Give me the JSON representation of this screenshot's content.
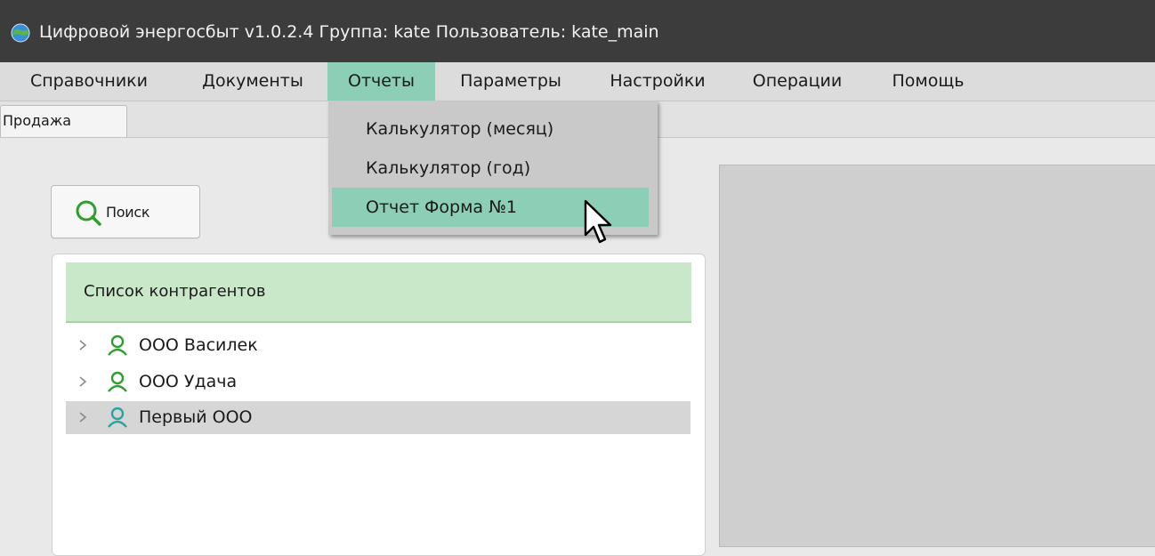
{
  "window": {
    "title": "Цифровой энергосбыт v1.0.2.4 Группа: kate Пользователь: kate_main",
    "app_icon": "globe-icon"
  },
  "menubar": {
    "items": [
      {
        "label": "Справочники"
      },
      {
        "label": "Документы"
      },
      {
        "label": "Отчеты",
        "active": true
      },
      {
        "label": "Параметры"
      },
      {
        "label": "Настройки"
      },
      {
        "label": "Операции"
      },
      {
        "label": "Помощь"
      }
    ]
  },
  "dropdown": {
    "items": [
      {
        "label": "Калькулятор (месяц)"
      },
      {
        "label": "Калькулятор (год)"
      },
      {
        "label": "Отчет Форма №1",
        "highlighted": true
      }
    ]
  },
  "tabs": [
    {
      "label": "Продажа"
    }
  ],
  "search": {
    "label": "Поиск",
    "icon": "search-icon"
  },
  "contractors": {
    "header": "Список контрагентов",
    "items": [
      {
        "label": "ООО Василек"
      },
      {
        "label": "ООО Удача"
      },
      {
        "label": "Первый ООО",
        "selected": true
      }
    ]
  },
  "colors": {
    "titlebar": "#3c3c3c",
    "accent": "#8ccfb6",
    "list_header": "#c9e8c9",
    "icon_green": "#2f9e2f",
    "icon_teal": "#2aa6a0"
  }
}
